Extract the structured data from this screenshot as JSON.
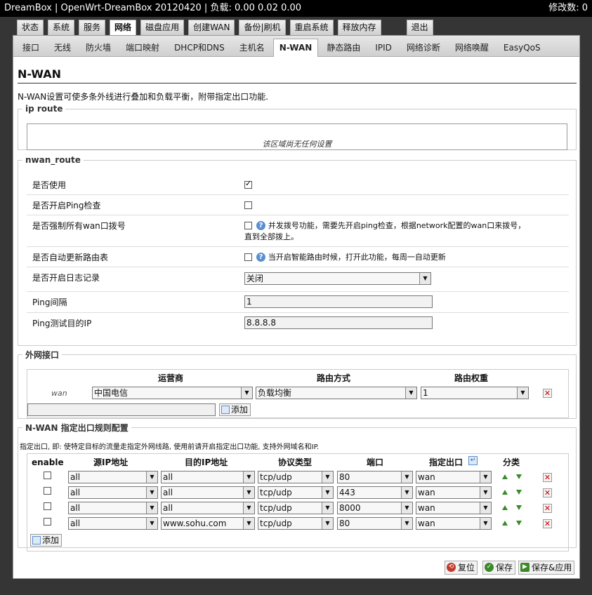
{
  "header": {
    "title": "DreamBox | OpenWrt-DreamBox 20120420 | 负载: 0.00 0.02 0.00",
    "changes": "修改数: 0"
  },
  "main_tabs": [
    "状态",
    "系统",
    "服务",
    "网络",
    "磁盘应用",
    "创建WAN",
    "备份|刷机",
    "重启系统",
    "释放内存"
  ],
  "logout": "退出",
  "sub_tabs": [
    "接口",
    "无线",
    "防火墙",
    "端口映射",
    "DHCP和DNS",
    "主机名",
    "N-WAN",
    "静态路由",
    "IPID",
    "网络诊断",
    "网络唤醒",
    "EasyQoS"
  ],
  "page": {
    "title": "N-WAN",
    "description": "N-WAN设置可使多条外线进行叠加和负载平衡，附带指定出口功能."
  },
  "ip_route": {
    "legend": "ip route",
    "empty": "该区域尚无任何设置"
  },
  "nwan_route": {
    "legend": "nwan_route",
    "enable_label": "是否使用",
    "ping_check_label": "是否开启Ping检查",
    "force_dial_label": "是否强制所有wan口拨号",
    "force_dial_note_1": "并发拨号功能，需要先开启ping检查，根据network配置的wan口来拨号，",
    "force_dial_note_2": "直到全部拨上。",
    "auto_update_label": "是否自动更新路由表",
    "auto_update_note": "当开启智能路由时候，打开此功能，每周一自动更新",
    "log_label": "是否开启日志记录",
    "log_value": "关闭",
    "ping_interval_label": "Ping间隔",
    "ping_interval_value": "1",
    "ping_ip_label": "Ping测试目的IP",
    "ping_ip_value": "8.8.8.8"
  },
  "wan_iface": {
    "legend": "外网接口",
    "col_isp": "运营商",
    "col_mode": "路由方式",
    "col_weight": "路由权重",
    "row_name": "wan",
    "isp": "中国电信",
    "mode": "负载均衡",
    "weight": "1",
    "add": "添加"
  },
  "rules": {
    "legend": "N-WAN 指定出口规则配置",
    "description": "指定出口, 即: 使特定目标的流量走指定外网线路, 使用前请开启指定出口功能, 支持外网域名和IP.",
    "headers": {
      "enable": "enable",
      "src": "源IP地址",
      "dst": "目的IP地址",
      "proto": "协议类型",
      "port": "端口",
      "out": "指定出口",
      "sort": "分类"
    },
    "rows": [
      {
        "src": "all",
        "dst": "all",
        "proto": "tcp/udp",
        "port": "80",
        "out": "wan"
      },
      {
        "src": "all",
        "dst": "all",
        "proto": "tcp/udp",
        "port": "443",
        "out": "wan"
      },
      {
        "src": "all",
        "dst": "all",
        "proto": "tcp/udp",
        "port": "8000",
        "out": "wan"
      },
      {
        "src": "all",
        "dst": "www.sohu.com",
        "proto": "tcp/udp",
        "port": "80",
        "out": "wan"
      }
    ],
    "add": "添加"
  },
  "actions": {
    "reset": "复位",
    "save": "保存",
    "save_apply": "保存&应用"
  },
  "colors": {
    "accent_blue": "#5a8fd0",
    "delete_red": "#cc0000",
    "arrow_green": "#3a8a2a"
  }
}
